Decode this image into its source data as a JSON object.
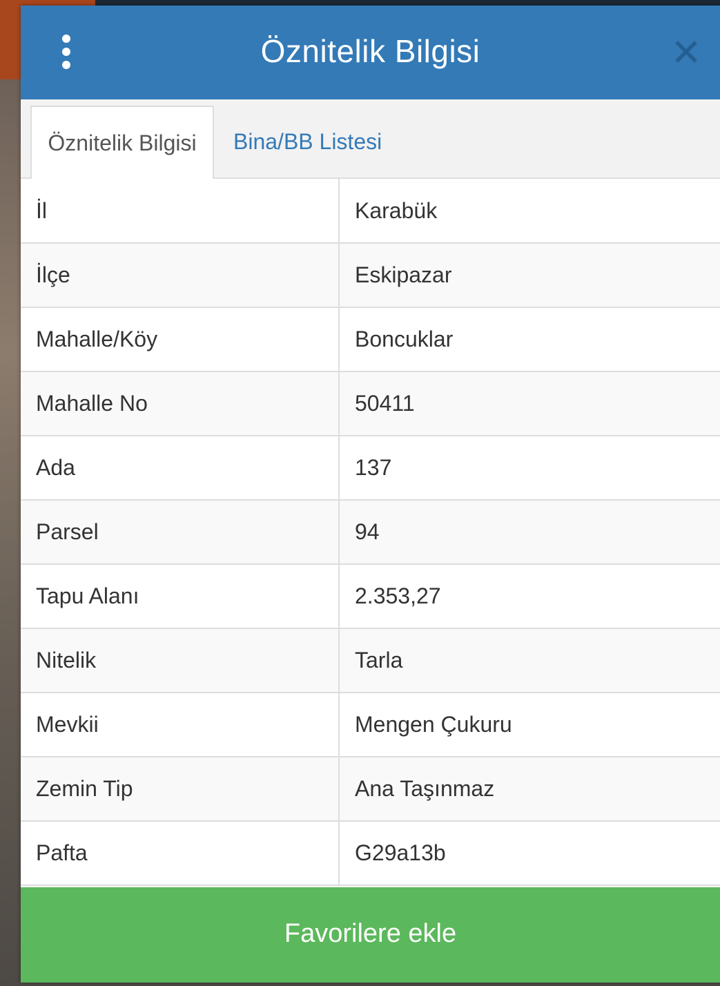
{
  "dialog": {
    "title": "Öznitelik Bilgisi",
    "menu_icon": "more-vertical-icon",
    "close_icon": "close-icon",
    "header_color": "#337ab7"
  },
  "tabs": [
    {
      "label": "Öznitelik Bilgisi",
      "active": true
    },
    {
      "label": "Bina/BB Listesi",
      "active": false
    }
  ],
  "attributes": [
    {
      "key": "İl",
      "value": "Karabük"
    },
    {
      "key": "İlçe",
      "value": "Eskipazar"
    },
    {
      "key": "Mahalle/Köy",
      "value": "Boncuklar"
    },
    {
      "key": "Mahalle No",
      "value": "50411"
    },
    {
      "key": "Ada",
      "value": "137"
    },
    {
      "key": "Parsel",
      "value": "94"
    },
    {
      "key": "Tapu Alanı",
      "value": "2.353,27"
    },
    {
      "key": "Nitelik",
      "value": "Tarla"
    },
    {
      "key": "Mevkii",
      "value": "Mengen Çukuru"
    },
    {
      "key": "Zemin Tip",
      "value": "Ana Taşınmaz"
    },
    {
      "key": "Pafta",
      "value": "G29a13b"
    }
  ],
  "footer": {
    "favorite_label": "Favorilere ekle",
    "button_color": "#5cb85c"
  }
}
